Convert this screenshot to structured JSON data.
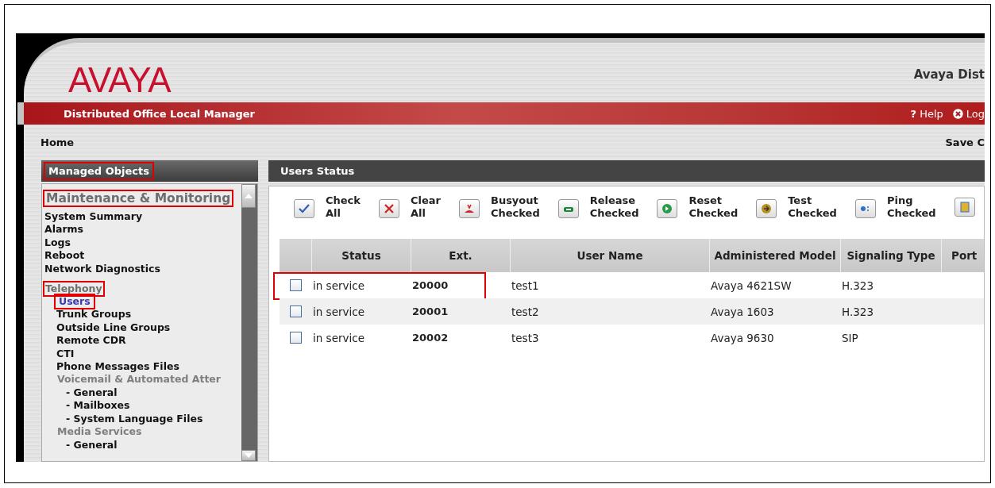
{
  "header": {
    "logo": "AVAYA",
    "product_title": "Avaya Dist",
    "app_name": "Distributed Office Local Manager",
    "links": [
      {
        "kind": "help",
        "glyph": "?",
        "label": "Help"
      },
      {
        "kind": "logout",
        "label": "Log"
      }
    ]
  },
  "nav": {
    "breadcrumb": "Home",
    "action": "Save C"
  },
  "sidebar": {
    "title": "Managed Objects",
    "highlighted": true,
    "sections": [
      {
        "title": "Maintenance & Monitoring",
        "highlighted": true,
        "items": [
          {
            "label": "System Summary",
            "selected": false,
            "highlighted": false
          },
          {
            "label": "Alarms",
            "selected": false,
            "highlighted": false
          },
          {
            "label": "Logs",
            "selected": false,
            "highlighted": false
          },
          {
            "label": "Reboot",
            "selected": false,
            "highlighted": false
          },
          {
            "label": "Network Diagnostics",
            "selected": false,
            "highlighted": false
          }
        ]
      },
      {
        "title": "Telephony",
        "highlighted": true,
        "items": [
          {
            "label": "Users",
            "selected": true,
            "highlighted": true
          },
          {
            "label": "Trunk Groups",
            "selected": false,
            "highlighted": false
          },
          {
            "label": "Outside Line Groups",
            "selected": false,
            "highlighted": false
          },
          {
            "label": "Remote CDR",
            "selected": false,
            "highlighted": false
          },
          {
            "label": "CTI",
            "selected": false,
            "highlighted": false
          },
          {
            "label": "Phone Messages Files",
            "selected": false,
            "highlighted": false
          },
          {
            "label": "Voicemail & Automated Atter",
            "children": [
              {
                "label": "- General",
                "selected": false,
                "highlighted": false
              },
              {
                "label": "- Mailboxes",
                "selected": false,
                "highlighted": false
              },
              {
                "label": "- System Language Files",
                "selected": false,
                "highlighted": false
              }
            ]
          },
          {
            "label": "Media Services",
            "children": [
              {
                "label": "- General",
                "selected": false,
                "highlighted": false
              }
            ]
          }
        ]
      }
    ]
  },
  "panel": {
    "title": "Users Status",
    "toolbar": [
      {
        "kind": "check",
        "label": "Check All"
      },
      {
        "kind": "clear",
        "label": "Clear All"
      },
      {
        "kind": "busyout",
        "label": "Busyout Checked"
      },
      {
        "kind": "release",
        "label": "Release Checked"
      },
      {
        "kind": "reset",
        "label": "Reset Checked"
      },
      {
        "kind": "test",
        "label": "Test Checked"
      },
      {
        "kind": "ping",
        "label": "Ping Checked"
      },
      {
        "kind": "other"
      }
    ],
    "table": {
      "columns": [
        "Status",
        "Ext.",
        "User Name",
        "Administered Model",
        "Signaling Type",
        "Port"
      ],
      "rows": [
        {
          "checked": false,
          "highlighted": true,
          "status": "in service",
          "ext": "20000",
          "user_name": "test1",
          "model": "Avaya 4621SW",
          "signaling": "H.323"
        },
        {
          "checked": false,
          "highlighted": false,
          "status": "in service",
          "ext": "20001",
          "user_name": "test2",
          "model": "Avaya 1603",
          "signaling": "H.323"
        },
        {
          "checked": false,
          "highlighted": false,
          "status": "in service",
          "ext": "20002",
          "user_name": "test3",
          "model": "Avaya 9630",
          "signaling": "SIP"
        }
      ]
    }
  }
}
